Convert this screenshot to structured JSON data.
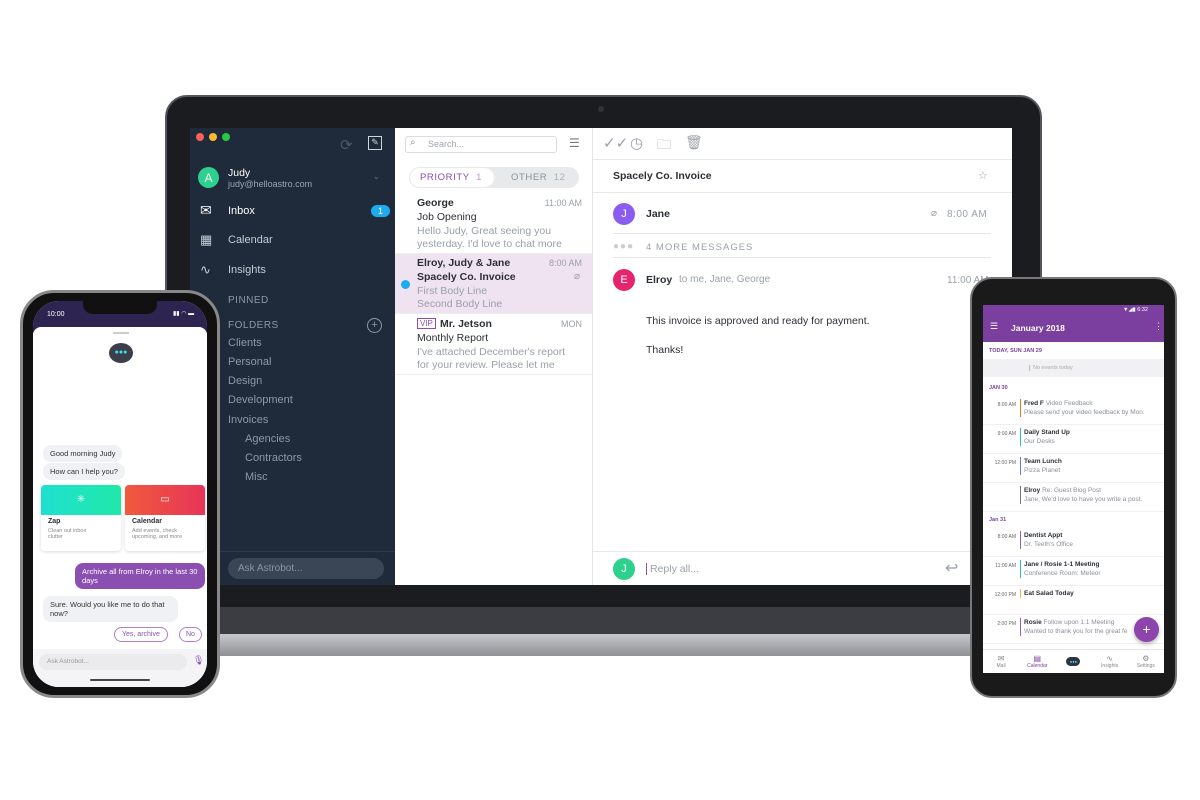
{
  "laptop": {
    "sidebar": {
      "user_name": "Judy",
      "user_email": "judy@helloastro.com",
      "avatar_letter": "A",
      "items": [
        {
          "label": "Inbox",
          "badge": "1"
        },
        {
          "label": "Calendar"
        },
        {
          "label": "Insights"
        }
      ],
      "pinned_label": "PINNED",
      "folders_label": "FOLDERS",
      "folders": [
        "Clients",
        "Personal",
        "Design",
        "Development",
        "Invoices"
      ],
      "subfolders": [
        "Agencies",
        "Contractors",
        "Misc"
      ],
      "ask_placeholder": "Ask Astrobot..."
    },
    "list": {
      "search_placeholder": "Search...",
      "tabs": [
        {
          "label": "PRIORITY",
          "count": "1"
        },
        {
          "label": "OTHER",
          "count": "12"
        }
      ],
      "messages": [
        {
          "sender": "George",
          "time": "11:00 AM",
          "subject": "Job Opening",
          "line1": "Hello Judy, Great seeing you",
          "line2": "yesterday. I'd love to chat more"
        },
        {
          "sender": "Elroy, Judy & Jane",
          "time": "8:00 AM",
          "subject": "Spacely Co. Invoice",
          "line1": "First Body Line",
          "line2": "Second Body Line"
        },
        {
          "badge": "VIP",
          "sender": "Mr. Jetson",
          "time": "MON",
          "subject": "Monthly Report",
          "line1": "I've attached December's report",
          "line2": "for your review. Please let me"
        }
      ]
    },
    "reader": {
      "subject": "Spacely Co. Invoice",
      "first": {
        "letter": "J",
        "name": "Jane",
        "time": "8:00 AM"
      },
      "more": "4 MORE MESSAGES",
      "last": {
        "letter": "E",
        "name": "Elroy",
        "recipients": "to me, Jane, George",
        "time": "11:00 AM",
        "body1": "This invoice is approved and ready for payment.",
        "body2": "Thanks!"
      },
      "reply_letter": "J",
      "reply_placeholder": "Reply all..."
    }
  },
  "iphone": {
    "time": "10:00",
    "greeting": "Good morning Judy",
    "prompt": "How can I help you?",
    "cards": [
      {
        "title": "Zap",
        "desc1": "Clean out inbox",
        "desc2": "clutter"
      },
      {
        "title": "Calendar",
        "desc1": "Add events, check",
        "desc2": "upcoming, and more"
      }
    ],
    "user_msg": "Archive all from Elroy in the last 30 days",
    "bot_reply": "Sure. Would you like me to do that now?",
    "yes": "Yes, archive",
    "no": "No",
    "ask_placeholder": "Ask Astrobot..."
  },
  "android": {
    "time": "6:32",
    "title": "January 2018",
    "today": "TODAY, SUN JAN 29",
    "no_events": "No events today",
    "day1": "JAN 30",
    "day2": "Jan 31",
    "events1": [
      {
        "time": "8:00 AM",
        "title": "Fred F",
        "title2": "Video Feedback",
        "sub": "Please send your video feedback by Mon.",
        "color": "#e8732b"
      },
      {
        "time": "9:00 AM",
        "title": "Daily Stand Up",
        "sub": "Our Desks",
        "color": "#28c7a0"
      },
      {
        "time": "12:00 PM",
        "title": "Team Lunch",
        "sub": "Pizza Planet",
        "color": "#5b7be0"
      },
      {
        "time": "",
        "title": "Elroy",
        "title2": "Re: Guest Blog Post",
        "sub": "Jane, We'd love to have you write a post.",
        "color": "#777777"
      }
    ],
    "events2": [
      {
        "time": "8:00 AM",
        "title": "Dentist Appt",
        "sub": "Dr. Teeth's Office",
        "color": "#8e5bd0"
      },
      {
        "time": "11:00 AM",
        "title": "Jane / Rosie 1-1 Meeting",
        "sub": "Conference Room: Meteor",
        "color": "#28c7a0"
      },
      {
        "time": "12:00 PM",
        "title": "Eat Salad Today",
        "sub": "",
        "color": "#f2b632"
      },
      {
        "time": "2:00 PM",
        "title": "Rosie",
        "title2": "Follow upon 1:1 Meeting",
        "sub": "Wanted to thank you for the great fe",
        "color": "#8e5bd0"
      }
    ],
    "nav": [
      "Mail",
      "Calendar",
      "",
      "Insights",
      "Settings"
    ]
  },
  "colors": {
    "accent": "#7b3fa0",
    "sidebar": "#1f2b3a",
    "unread": "#1eaaf1"
  }
}
